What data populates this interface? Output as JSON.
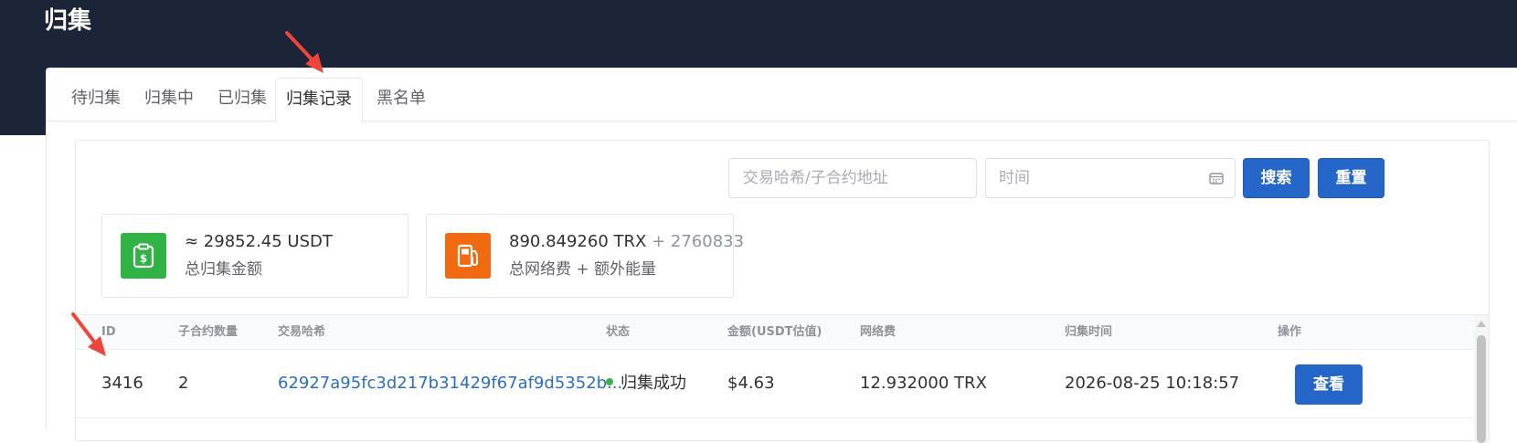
{
  "page": {
    "title": "归集"
  },
  "tabs": [
    {
      "label": "待归集"
    },
    {
      "label": "归集中"
    },
    {
      "label": "已归集"
    },
    {
      "label": "归集记录",
      "active": true
    },
    {
      "label": "黑名单"
    }
  ],
  "search": {
    "hash_placeholder": "交易哈希/子合约地址",
    "time_placeholder": "时间",
    "search_label": "搜索",
    "reset_label": "重置"
  },
  "stats": {
    "total_amount_value": "≈ 29852.45 USDT",
    "total_amount_label": "总归集金额",
    "fee_value": "890.849260 TRX",
    "fee_extra": "+ 2760833",
    "fee_label": "总网络费 + 额外能量"
  },
  "table": {
    "headers": [
      "ID",
      "子合约数量",
      "交易哈希",
      "状态",
      "金额(USDT估值)",
      "网络费",
      "归集时间",
      "操作"
    ],
    "rows": [
      {
        "id": "3416",
        "sub_count": "2",
        "hash": "62927a95fc3d217b31429f67af9d5352b...",
        "status": "归集成功",
        "amount": "$4.63",
        "fee": "12.932000 TRX",
        "time": "2026-08-25 10:18:57",
        "action": "查看"
      }
    ]
  },
  "colors": {
    "header_bg": "#1b2537",
    "primary": "#2567c9",
    "link": "#2a6fc4",
    "success": "#3bb34a",
    "green_icon": "#2fb344",
    "orange_icon": "#f26a0f",
    "annotation_arrow": "#f0453a"
  },
  "icons": {
    "stat_amount": "clipboard-dollar-icon",
    "stat_fee": "fuel-pump-icon",
    "time_input": "calendar-icon"
  }
}
